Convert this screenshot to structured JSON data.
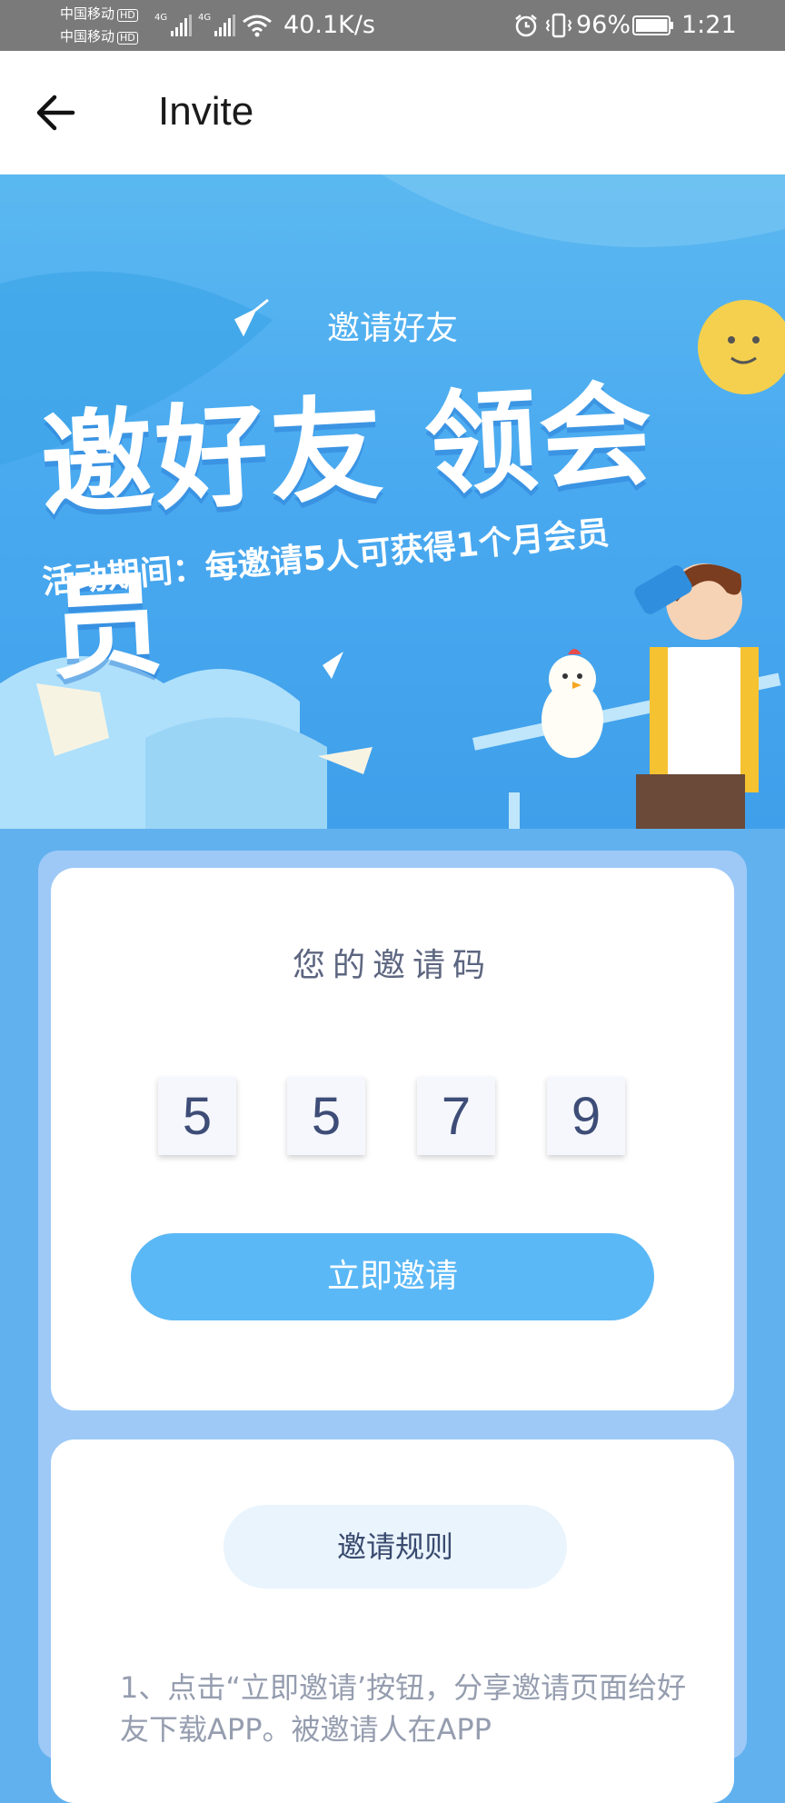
{
  "status_bar": {
    "carrier_1": "中国移动",
    "carrier_2": "中国移动",
    "hd_badge": "HD",
    "network_type": "4G",
    "net_speed": "40.1K/s",
    "battery_percent": "96%",
    "battery_level": 0.96,
    "time": "1:21",
    "icons": [
      "signal-icon",
      "wifi-icon",
      "alarm-icon",
      "vibrate-icon",
      "battery-icon"
    ]
  },
  "header": {
    "title": "Invite",
    "back_icon": "arrow-left-icon"
  },
  "banner": {
    "small_title": "邀请好友",
    "headline": "邀好友 领会员",
    "subtitle": "活动期间：每邀请5人可获得1个月会员"
  },
  "invite_code": {
    "label": "您的邀请码",
    "digits": [
      "5",
      "5",
      "7",
      "9"
    ],
    "button_label": "立即邀请"
  },
  "rules": {
    "title": "邀请规则",
    "text": "1、点击“立即邀请’按钮，分享邀请页面给好友下载APP。被邀请人在APP"
  },
  "colors": {
    "accent": "#5bb8f6",
    "page_background": "#62b1ef",
    "card_wrapper": "#9ec9f7",
    "digit_text": "#3e4d77"
  }
}
